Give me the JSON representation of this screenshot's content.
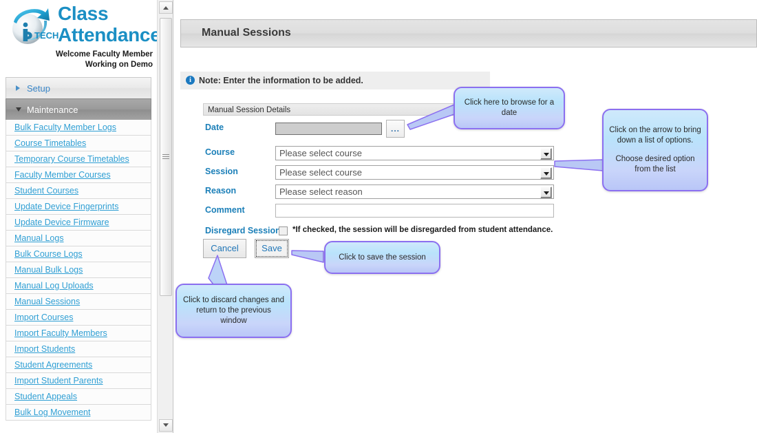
{
  "brand": {
    "logo_icon": "iptech-sphere-logo",
    "title_line1": "Class",
    "title_line2": "Attendance",
    "welcome_line1": "Welcome Faculty Member",
    "welcome_line2": "Working on Demo"
  },
  "sidebar": {
    "sections": [
      {
        "label": "Setup",
        "expanded": false,
        "icon": "chevron-right-icon"
      },
      {
        "label": "Maintenance",
        "expanded": true,
        "icon": "chevron-down-icon"
      }
    ],
    "items": [
      {
        "label": "Bulk Faculty Member Logs"
      },
      {
        "label": "Course Timetables"
      },
      {
        "label": "Temporary Course Timetables"
      },
      {
        "label": "Faculty Member Courses"
      },
      {
        "label": "Student Courses"
      },
      {
        "label": "Update Device Fingerprints"
      },
      {
        "label": "Update Device Firmware"
      },
      {
        "label": "Manual Logs"
      },
      {
        "label": "Bulk Course Logs"
      },
      {
        "label": "Manual Bulk Logs"
      },
      {
        "label": "Manual Log Uploads"
      },
      {
        "label": "Manual Sessions"
      },
      {
        "label": "Import Courses"
      },
      {
        "label": "Import Faculty Members"
      },
      {
        "label": "Import Students"
      },
      {
        "label": "Student Agreements"
      },
      {
        "label": "Import Student Parents"
      },
      {
        "label": "Student Appeals"
      },
      {
        "label": "Bulk Log Movement"
      }
    ],
    "scrollbar": {
      "up_icon": "scroll-up-arrow-icon",
      "down_icon": "scroll-down-arrow-icon",
      "grip_icon": "scrollbar-grip-icon"
    }
  },
  "main": {
    "page_title": "Manual Sessions",
    "note": {
      "icon": "info-icon",
      "icon_glyph": "i",
      "text": "Note: Enter the information to be added."
    },
    "form": {
      "section_header": "Manual Session Details",
      "date": {
        "label": "Date",
        "value": "",
        "browse_button_label": "...",
        "browse_button_icon": "ellipsis-browse-icon"
      },
      "course": {
        "label": "Course",
        "selected": "Please select course",
        "arrow_icon": "chevron-down-icon"
      },
      "session": {
        "label": "Session",
        "selected": "Please select course",
        "arrow_icon": "chevron-down-icon"
      },
      "reason": {
        "label": "Reason",
        "selected": "Please select reason",
        "arrow_icon": "chevron-down-icon"
      },
      "comment": {
        "label": "Comment",
        "value": ""
      },
      "disregard": {
        "label": "Disregard Session",
        "checked": false,
        "hint": "*If checked, the session will be disregarded from student attendance."
      }
    },
    "buttons": {
      "cancel": "Cancel",
      "save": "Save"
    }
  },
  "callouts": {
    "date": {
      "text": "Click here to browse for a date"
    },
    "dropdown": {
      "line1": "Click on the arrow to bring down a list of options.",
      "line2": "Choose desired option from the list"
    },
    "save": {
      "text": "Click to save the session"
    },
    "cancel": {
      "text": "Click to discard changes and return to the previous window"
    }
  },
  "colors": {
    "brand_blue": "#1b8fc4",
    "link_blue": "#2f9fd4",
    "label_blue": "#1b7fb8",
    "callout_border": "#8b6ff0",
    "active_section_bg": "#9a9a9a"
  }
}
